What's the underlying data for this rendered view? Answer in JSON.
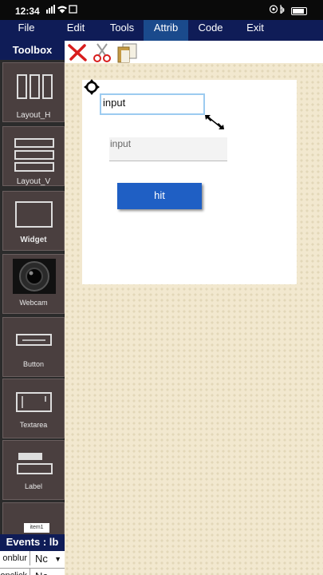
{
  "status_bar": {
    "time": "12:34",
    "left_icons": "▮▮ ᯤ ⧉",
    "right_icons": "◉ ✱ ⏍"
  },
  "menu": {
    "file": "File",
    "edit": "Edit",
    "tools": "Tools",
    "attrib": "Attrib",
    "code": "Code",
    "exit": "Exit"
  },
  "toolbox": {
    "title": "Toolbox",
    "items": [
      {
        "label": "Layout_H",
        "icon": "layout-horizontal-icon"
      },
      {
        "label": "Layout_V",
        "icon": "layout-vertical-icon"
      },
      {
        "label": "Widget",
        "icon": "widget-icon"
      },
      {
        "label": "Webcam",
        "icon": "webcam-icon"
      },
      {
        "label": "Button",
        "icon": "button-icon"
      },
      {
        "label": "Textarea",
        "icon": "textarea-icon"
      },
      {
        "label": "Label",
        "icon": "label-icon"
      },
      {
        "label": "item1",
        "icon": "list-icon"
      }
    ]
  },
  "quick_tools": [
    "delete-icon",
    "cut-icon",
    "copy-icon"
  ],
  "form": {
    "input1_value": "input",
    "input2_placeholder": "input",
    "hit_label": "hit"
  },
  "events": {
    "title": "Events : lb",
    "rows": [
      {
        "event": "onblur",
        "selected": "Nc"
      },
      {
        "event": "onclick",
        "selected": "Nc"
      }
    ]
  },
  "colors": {
    "menubar": "#0f1c57",
    "active_tab": "#1a4a8c",
    "button": "#1f5fc4",
    "tool_bg": "#4a3f3f",
    "canvas": "#f2e8cf"
  }
}
